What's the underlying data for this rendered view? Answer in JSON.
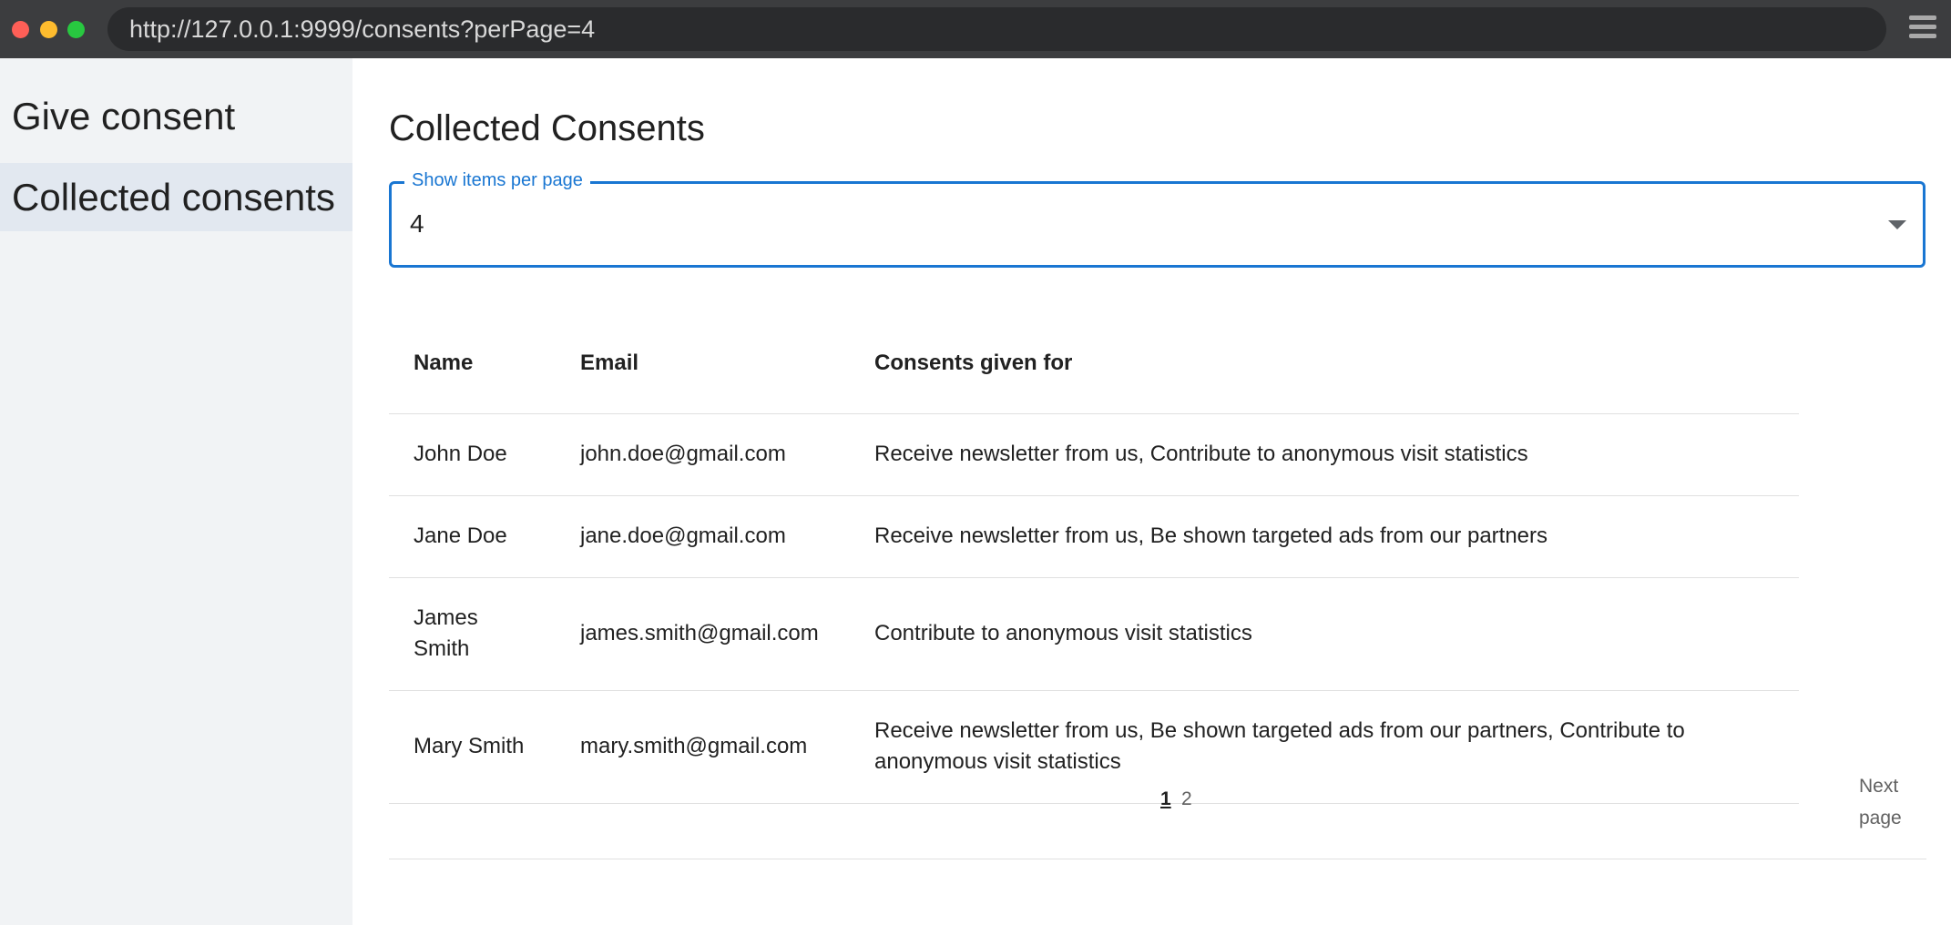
{
  "browser": {
    "url": "http://127.0.0.1:9999/consents?perPage=4"
  },
  "sidebar": {
    "items": [
      {
        "label": "Give consent",
        "active": false
      },
      {
        "label": "Collected consents",
        "active": true
      }
    ]
  },
  "main": {
    "title": "Collected Consents",
    "per_page": {
      "label": "Show items per page",
      "value": "4"
    },
    "table": {
      "headers": [
        "Name",
        "Email",
        "Consents given for"
      ],
      "rows": [
        {
          "name": "John Doe",
          "email": "john.doe@gmail.com",
          "consents": "Receive newsletter from us, Contribute to anonymous visit statistics"
        },
        {
          "name": "Jane Doe",
          "email": "jane.doe@gmail.com",
          "consents": "Receive newsletter from us, Be shown targeted ads from our partners"
        },
        {
          "name": "James Smith",
          "email": "james.smith@gmail.com",
          "consents": "Contribute to anonymous visit statistics"
        },
        {
          "name": "Mary Smith",
          "email": "mary.smith@gmail.com",
          "consents": "Receive newsletter from us, Be shown targeted ads from our partners, Contribute to anonymous visit statistics"
        }
      ]
    },
    "pagination": {
      "pages": [
        "1",
        "2"
      ],
      "current": "1",
      "next_label": "Next page"
    }
  },
  "colors": {
    "accent": "#1976d2",
    "sidebar_bg": "#f1f3f5",
    "active_nav_bg": "#e2e8f0"
  }
}
